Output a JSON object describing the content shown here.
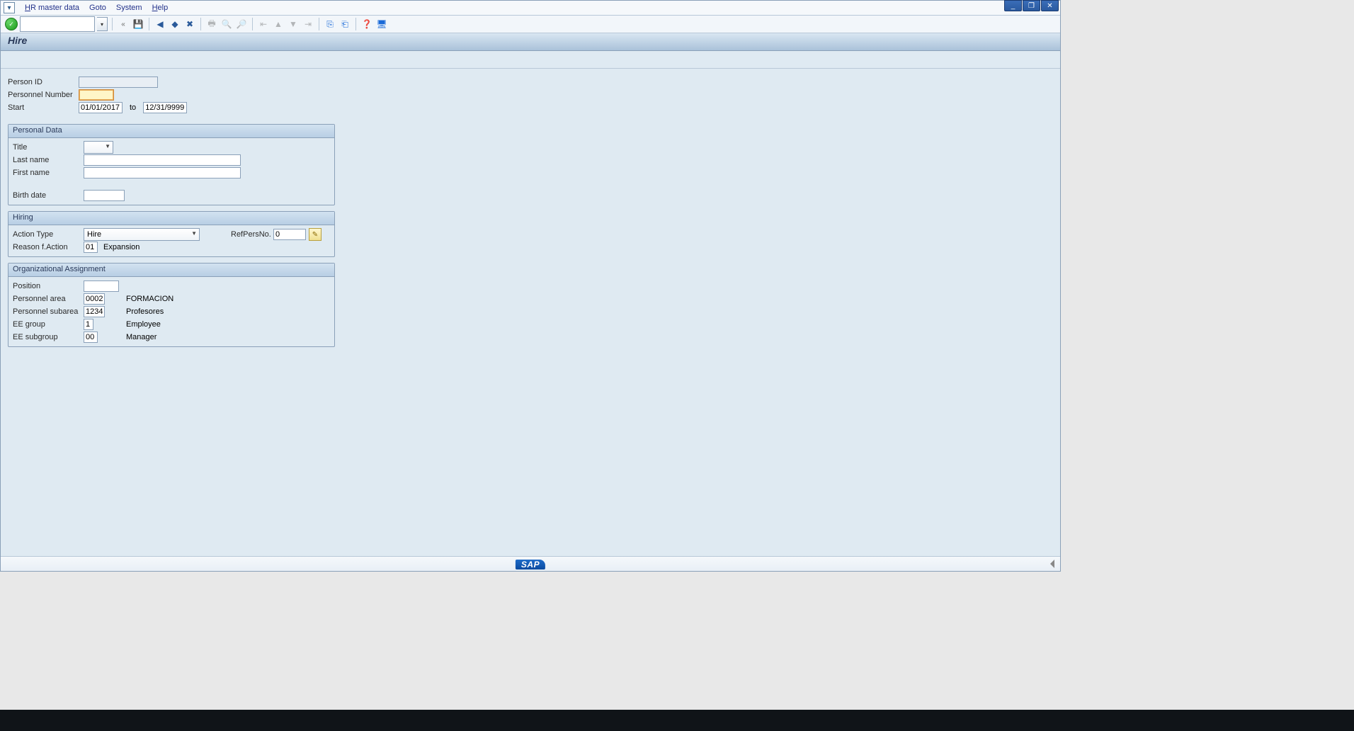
{
  "menu": {
    "items": [
      "HR master data",
      "Goto",
      "System",
      "Help"
    ]
  },
  "window_controls": {
    "minimize": "_",
    "maximize": "❐",
    "close": "✕"
  },
  "toolbar": {
    "icons": [
      "save",
      "back",
      "exit",
      "cancel",
      "print",
      "find",
      "findnext",
      "first",
      "prevpage",
      "nextpage",
      "last",
      "newsession",
      "shortcut",
      "help",
      "layout"
    ]
  },
  "title": "Hire",
  "header": {
    "person_id_label": "Person ID",
    "personnel_number_label": "Personnel Number",
    "start_label": "Start",
    "start_value": "01/01/2017",
    "to_label": "to",
    "end_value": "12/31/9999"
  },
  "personal_data": {
    "legend": "Personal Data",
    "title_label": "Title",
    "last_name_label": "Last name",
    "first_name_label": "First name",
    "birth_date_label": "Birth date"
  },
  "hiring": {
    "legend": "Hiring",
    "action_type_label": "Action Type",
    "action_type_value": "Hire",
    "reason_label": "Reason f.Action",
    "reason_code": "01",
    "reason_text": "Expansion",
    "refpersno_label": "RefPersNo.",
    "refpersno_value": "0"
  },
  "org": {
    "legend": "Organizational Assignment",
    "position_label": "Position",
    "personnel_area_label": "Personnel area",
    "personnel_area_code": "0002",
    "personnel_area_text": "FORMACION",
    "personnel_subarea_label": "Personnel subarea",
    "personnel_subarea_code": "1234",
    "personnel_subarea_text": "Profesores",
    "ee_group_label": "EE group",
    "ee_group_code": "1",
    "ee_group_text": "Employee",
    "ee_subgroup_label": "EE subgroup",
    "ee_subgroup_code": "00",
    "ee_subgroup_text": "Manager"
  },
  "status": {
    "logo": "SAP"
  }
}
